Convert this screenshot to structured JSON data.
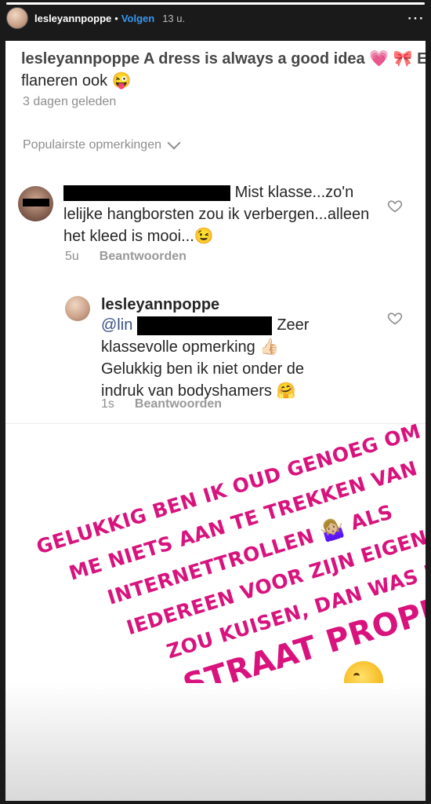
{
  "header": {
    "username": "lesleyannpoppe",
    "separator": "•",
    "follow_label": "Volgen",
    "time": "13 u.",
    "more_label": "⋯",
    "progress": 1.0
  },
  "post": {
    "cut_text": "lesleyannpoppe A dress is always a good idea 💗 🎀 En",
    "line2": "flaneren ook 😜",
    "meta": "3 dagen geleden",
    "popular_label": "Populairste opmerkingen"
  },
  "comments": [
    {
      "text": "Mist klasse...zo'n lelijke hangborsten zou ik verbergen...alleen het kleed is mooi...😉",
      "time": "5u",
      "reply_label": "Beantwoorden"
    },
    {
      "username": "lesleyannpoppe",
      "mention": "@lin",
      "text": "Zeer klassevolle opmerking 👍🏻 Gelukkig ben ik niet onder de indruk van bodyshamers 🤗",
      "time": "1s",
      "reply_label": "Beantwoorden"
    }
  ],
  "story_text": {
    "line1": "Gelukkig ben ik oud genoeg om",
    "line2": "me niets aan te trekken van",
    "line3": "internettrollen 🤷🏼‍♀️ als",
    "line4": "iedereen voor zijn eigen deur",
    "line5": "zou kuisen, dan was heel de",
    "line6": "straat proper"
  },
  "colors": {
    "accent": "#3897f0",
    "story_text": "#d8137d"
  }
}
